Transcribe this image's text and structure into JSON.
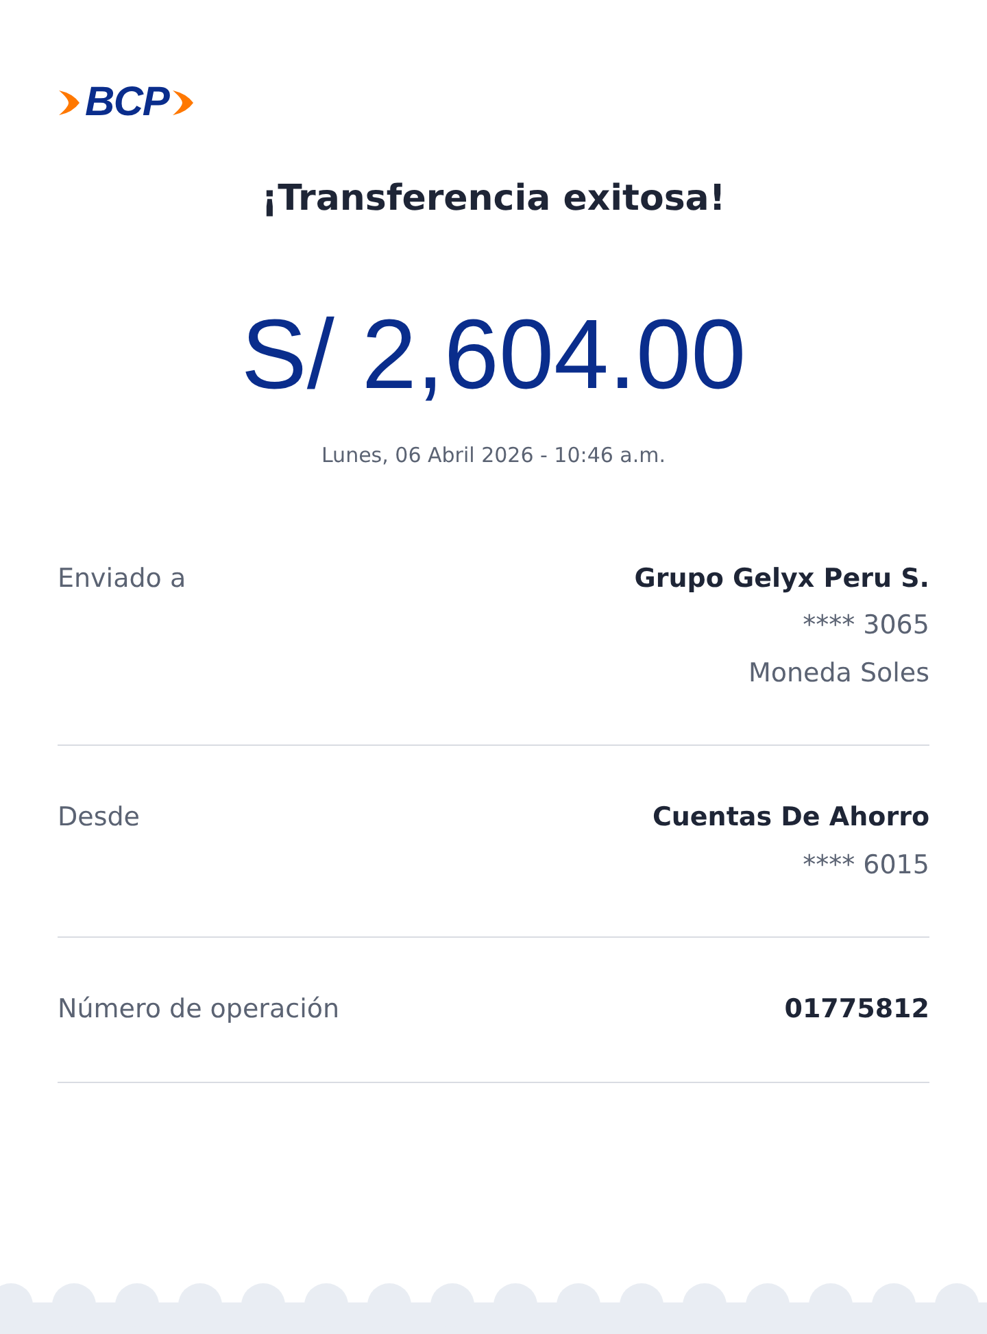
{
  "logo": {
    "text": "BCP"
  },
  "title": "¡Transferencia exitosa!",
  "amount": "S/ 2,604.00",
  "datetime": "Lunes, 06 Abril 2026 - 10:46 a.m.",
  "details": [
    {
      "label": "Enviado a",
      "values": [
        "Grupo Gelyx Peru S.",
        "**** 3065",
        "Moneda Soles"
      ]
    },
    {
      "label": "Desde",
      "values": [
        "Cuentas De Ahorro",
        "**** 6015"
      ]
    },
    {
      "label": "Número de operación",
      "values": [
        "01775812"
      ]
    }
  ]
}
